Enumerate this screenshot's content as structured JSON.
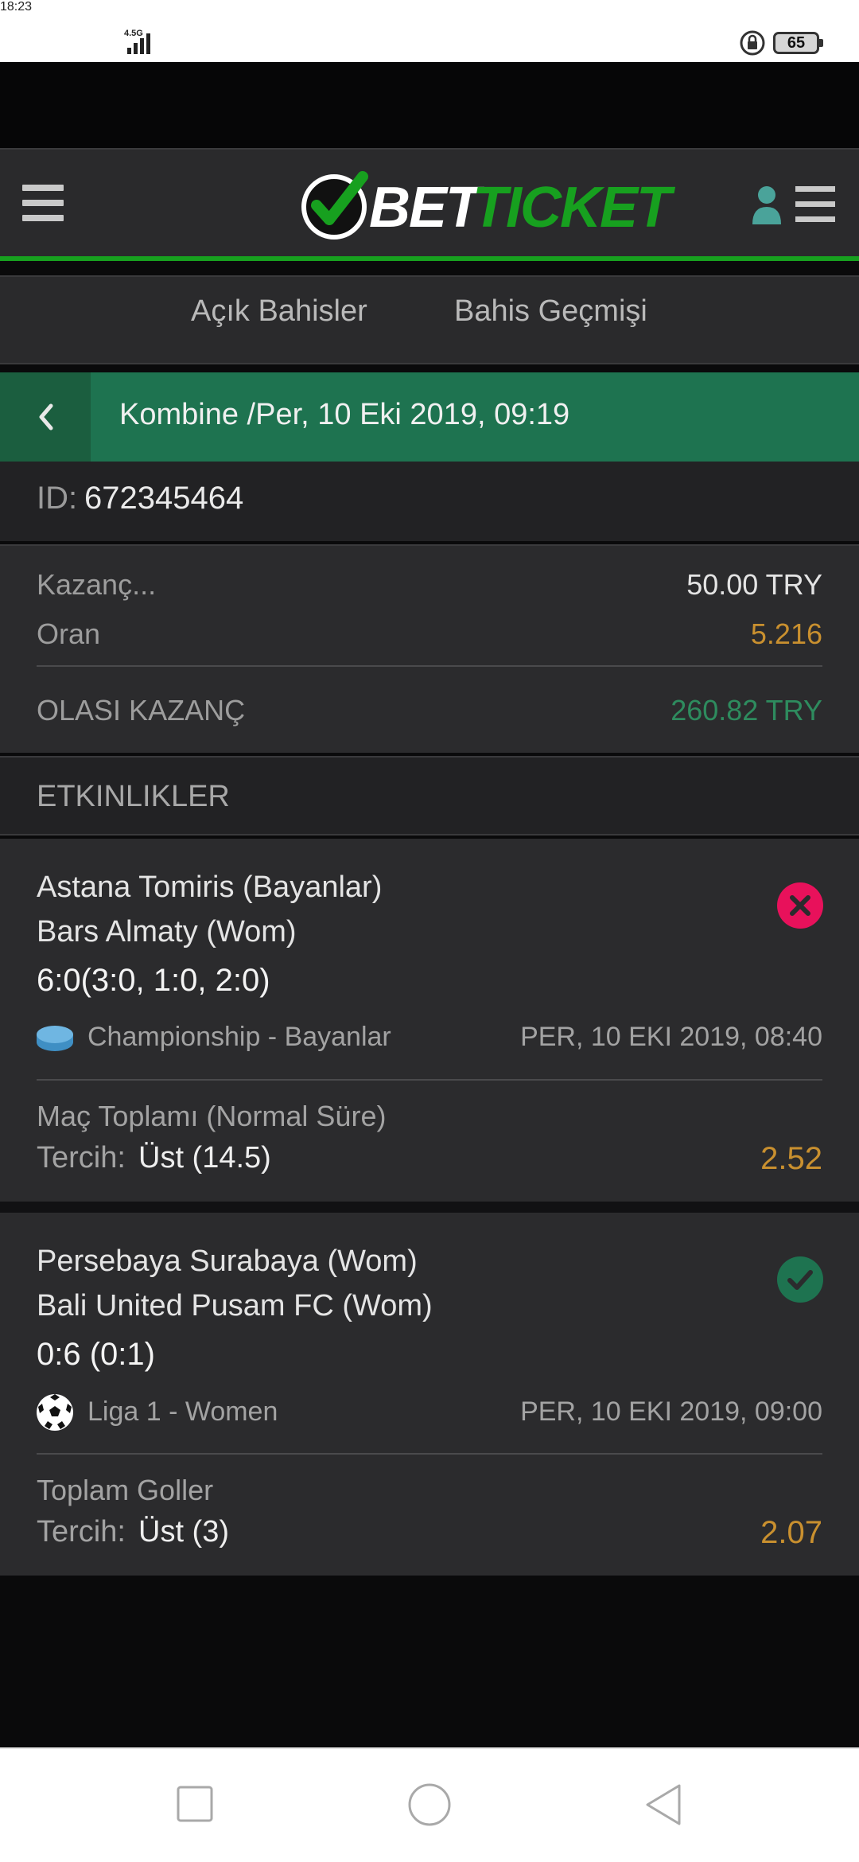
{
  "status_bar": {
    "time": "18:23",
    "network": "4.5G",
    "battery": "65"
  },
  "header": {
    "logo_text_1": "BET",
    "logo_text_2": "TICKET"
  },
  "tabs": [
    {
      "label": "Açık Bahisler"
    },
    {
      "label": "Bahis Geçmişi"
    }
  ],
  "bet": {
    "title": "Kombine /Per, 10 Eki 2019, 09:19",
    "id_label": "ID:",
    "id_value": "672345464",
    "stake_label": "Kazanç...",
    "stake_value": "50.00 TRY",
    "odds_label": "Oran",
    "odds_value": "5.216",
    "potential_label": "OLASI KAZANÇ",
    "potential_value": "260.82 TRY"
  },
  "events_header": "ETKINLIKLER",
  "events": [
    {
      "team1": "Astana Tomiris (Bayanlar)",
      "team2": "Bars Almaty (Wom)",
      "score": "6:0(3:0, 1:0, 2:0)",
      "league": "Championship - Bayanlar",
      "date": "PER, 10 EKI 2019, 08:40",
      "market": "Maç Toplamı (Normal Süre)",
      "pick_label": "Tercih:",
      "pick_value": "Üst (14.5)",
      "odd": "2.52",
      "status": "lost",
      "status_icon": "cross-icon",
      "sport_icon": "hockey-puck-icon"
    },
    {
      "team1": "Persebaya Surabaya (Wom)",
      "team2": "Bali United Pusam FC (Wom)",
      "score": "0:6 (0:1)",
      "league": "Liga 1 - Women",
      "date": "PER, 10 EKI 2019, 09:00",
      "market": "Toplam Goller",
      "pick_label": "Tercih:",
      "pick_value": "Üst (3)",
      "odd": "2.07",
      "status": "won",
      "status_icon": "check-icon",
      "sport_icon": "soccer-ball-icon"
    }
  ],
  "colors": {
    "accent_green": "#17a01f",
    "title_green": "#1e7350",
    "odds_gold": "#c9902f",
    "potential_green": "#2e8b5e",
    "lost_red": "#e8115b",
    "won_green": "#1e7350"
  }
}
